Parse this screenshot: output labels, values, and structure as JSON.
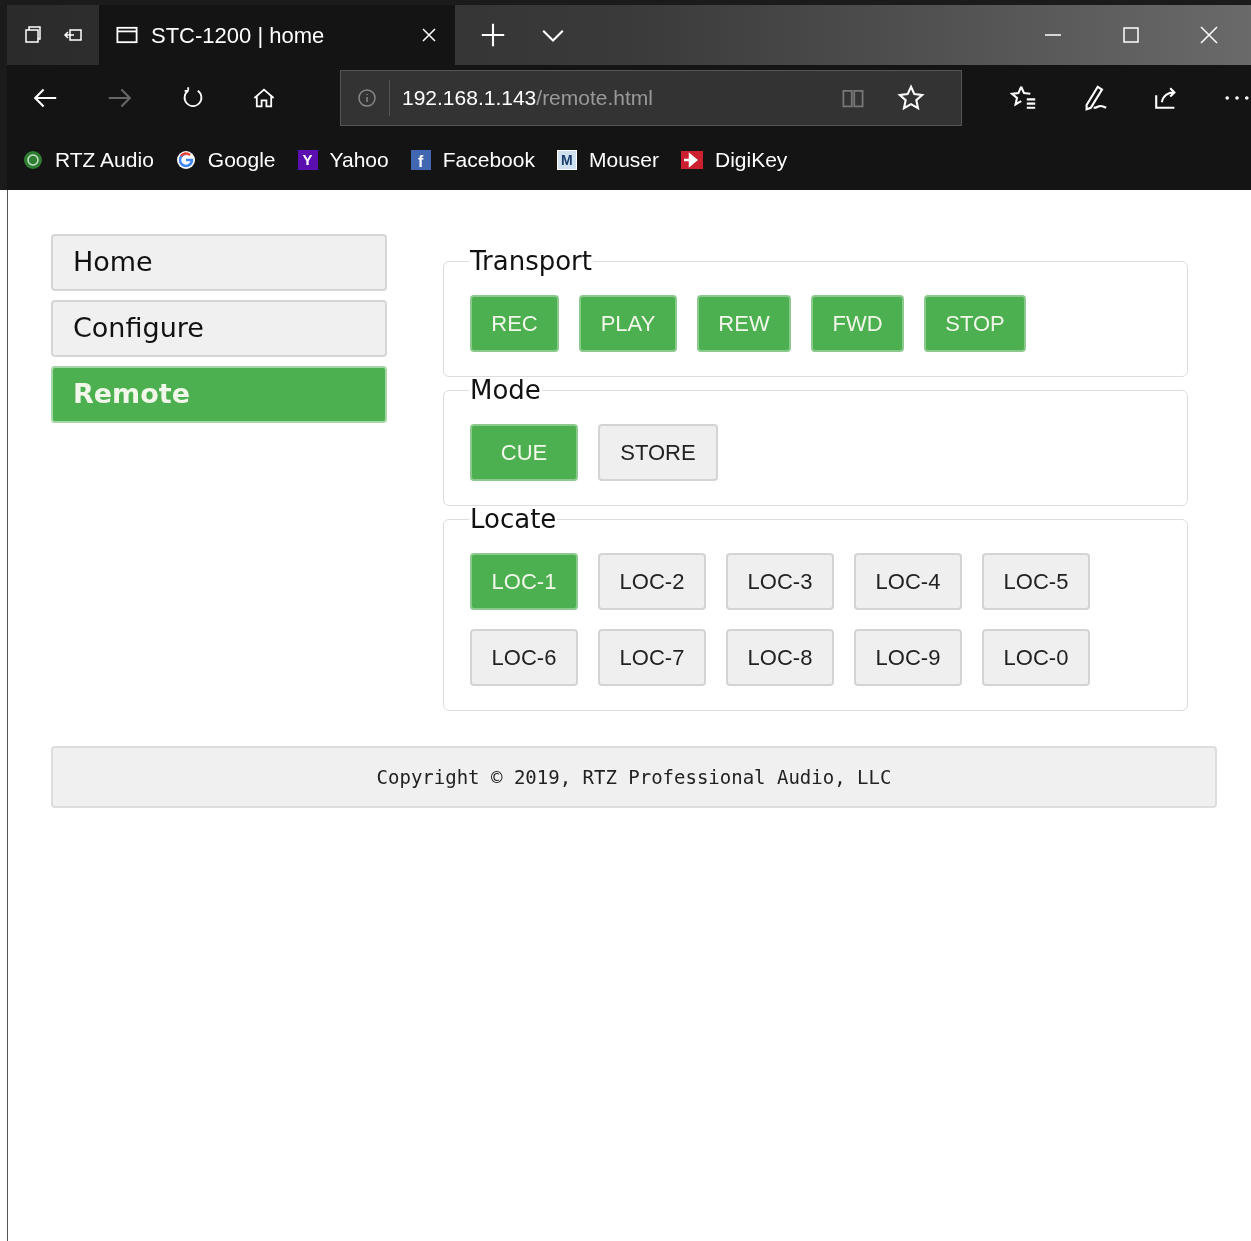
{
  "browser": {
    "tab_title": "STC-1200 | home",
    "address": {
      "host": "192.168.1.143",
      "path": "/remote.html"
    },
    "bookmarks": [
      {
        "kind": "rtz",
        "label": "RTZ Audio"
      },
      {
        "kind": "google",
        "label": "Google"
      },
      {
        "kind": "yahoo",
        "mark": "Y",
        "label": "Yahoo"
      },
      {
        "kind": "facebook",
        "mark": "f",
        "label": "Facebook"
      },
      {
        "kind": "mouser",
        "mark": "M",
        "label": "Mouser"
      },
      {
        "kind": "digikey",
        "label": "DigiKey"
      }
    ]
  },
  "sidebar": {
    "items": [
      {
        "label": "Home",
        "selected": false
      },
      {
        "label": "Configure",
        "selected": false
      },
      {
        "label": "Remote",
        "selected": true
      }
    ]
  },
  "groups": [
    {
      "legend": "Transport",
      "buttons": [
        {
          "label": "REC",
          "selected": true
        },
        {
          "label": "PLAY",
          "selected": true
        },
        {
          "label": "REW",
          "selected": true
        },
        {
          "label": "FWD",
          "selected": true
        },
        {
          "label": "STOP",
          "selected": true
        }
      ]
    },
    {
      "legend": "Mode",
      "buttons": [
        {
          "label": "CUE",
          "selected": true
        },
        {
          "label": "STORE",
          "selected": false
        }
      ]
    },
    {
      "legend": "Locate",
      "buttons": [
        {
          "label": "LOC-1",
          "selected": true
        },
        {
          "label": "LOC-2",
          "selected": false
        },
        {
          "label": "LOC-3",
          "selected": false
        },
        {
          "label": "LOC-4",
          "selected": false
        },
        {
          "label": "LOC-5",
          "selected": false
        },
        {
          "label": "LOC-6",
          "selected": false
        },
        {
          "label": "LOC-7",
          "selected": false
        },
        {
          "label": "LOC-8",
          "selected": false
        },
        {
          "label": "LOC-9",
          "selected": false
        },
        {
          "label": "LOC-0",
          "selected": false
        }
      ]
    }
  ],
  "footer": "Copyright © 2019, RTZ Professional Audio, LLC"
}
